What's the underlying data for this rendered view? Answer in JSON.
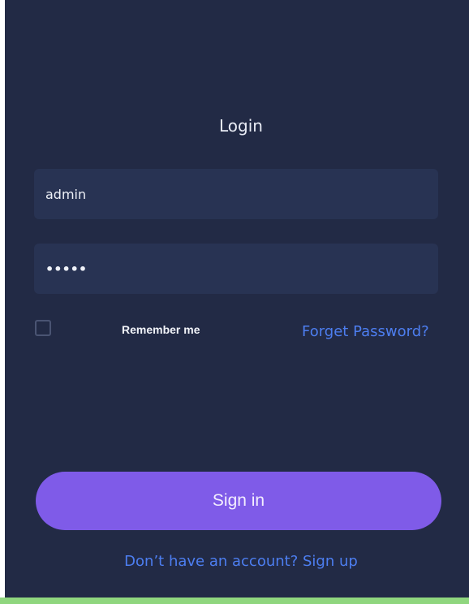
{
  "login": {
    "title": "Login",
    "username_value": "admin",
    "password_value": "•••••",
    "remember_label": "Remember me",
    "forget_label": "Forget Password?",
    "signin_label": "Sign in",
    "signup_label": "Don’t have an account? Sign up"
  }
}
